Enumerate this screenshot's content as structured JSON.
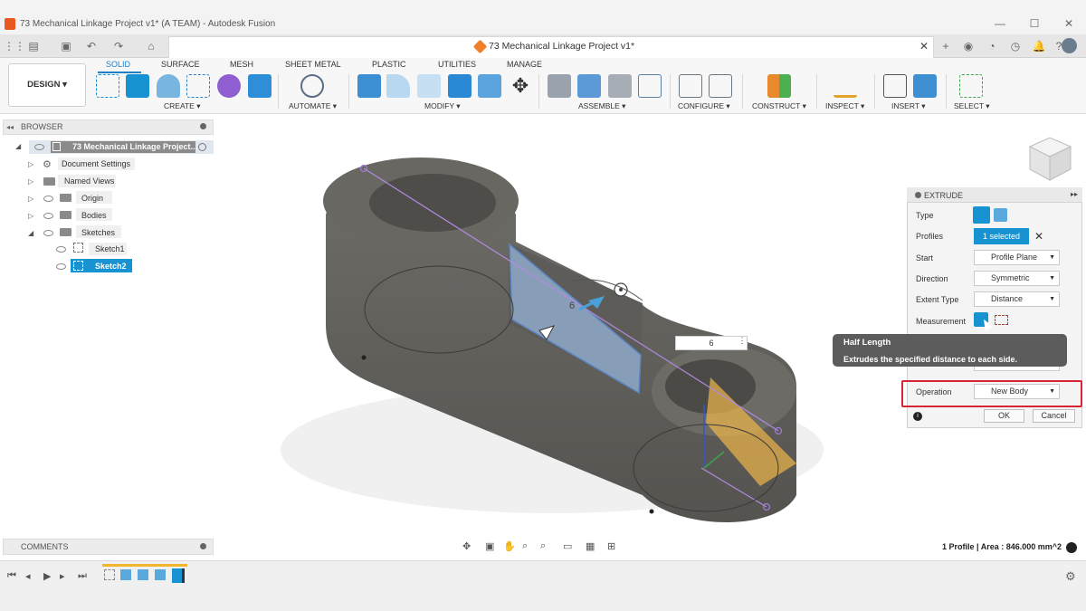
{
  "window": {
    "title": "73 Mechanical Linkage Project v1* (A TEAM) - Autodesk Fusion",
    "controls": [
      "minimize",
      "maximize",
      "close"
    ]
  },
  "tab": {
    "title": "73 Mechanical Linkage Project v1*",
    "close_glyph": "✕"
  },
  "workspace": {
    "label": "DESIGN ▾"
  },
  "ribbon": {
    "tabs": [
      {
        "label": "SOLID",
        "active": true
      },
      {
        "label": "SURFACE"
      },
      {
        "label": "MESH"
      },
      {
        "label": "SHEET METAL"
      },
      {
        "label": "PLASTIC"
      },
      {
        "label": "UTILITIES"
      },
      {
        "label": "MANAGE"
      }
    ],
    "groups": [
      {
        "label": "CREATE ▾"
      },
      {
        "label": "AUTOMATE ▾"
      },
      {
        "label": "MODIFY ▾"
      },
      {
        "label": "ASSEMBLE ▾"
      },
      {
        "label": "CONFIGURE ▾"
      },
      {
        "label": "CONSTRUCT ▾"
      },
      {
        "label": "INSPECT ▾"
      },
      {
        "label": "INSERT ▾"
      },
      {
        "label": "SELECT ▾"
      }
    ]
  },
  "browser": {
    "title": "BROWSER",
    "nodes": [
      {
        "label": "73 Mechanical Linkage Project..."
      },
      {
        "label": "Document Settings"
      },
      {
        "label": "Named Views"
      },
      {
        "label": "Origin"
      },
      {
        "label": "Bodies"
      },
      {
        "label": "Sketches"
      },
      {
        "label": "Sketch1"
      },
      {
        "label": "Sketch2"
      }
    ]
  },
  "comments": {
    "title": "COMMENTS"
  },
  "extrude": {
    "title": "EXTRUDE",
    "labels": {
      "type": "Type",
      "profiles": "Profiles",
      "start": "Start",
      "direction": "Direction",
      "extent_type": "Extent Type",
      "measurement": "Measurement",
      "operation": "Operation"
    },
    "values": {
      "profiles": "1 selected",
      "start": "Profile Plane",
      "direction": "Symmetric",
      "extent_type": "Distance",
      "operation": "New Body"
    },
    "buttons": {
      "ok": "OK",
      "cancel": "Cancel"
    }
  },
  "tooltip": {
    "title": "Half Length",
    "body": "Extrudes the specified distance to each side."
  },
  "viewport": {
    "dimension_value": "6",
    "dimension_label": "6"
  },
  "status": {
    "text": "1 Profile | Area : 846.000 mm^2"
  },
  "colors": {
    "accent": "#1793d1",
    "highlight": "#d62635",
    "body": "#6e6c67"
  }
}
